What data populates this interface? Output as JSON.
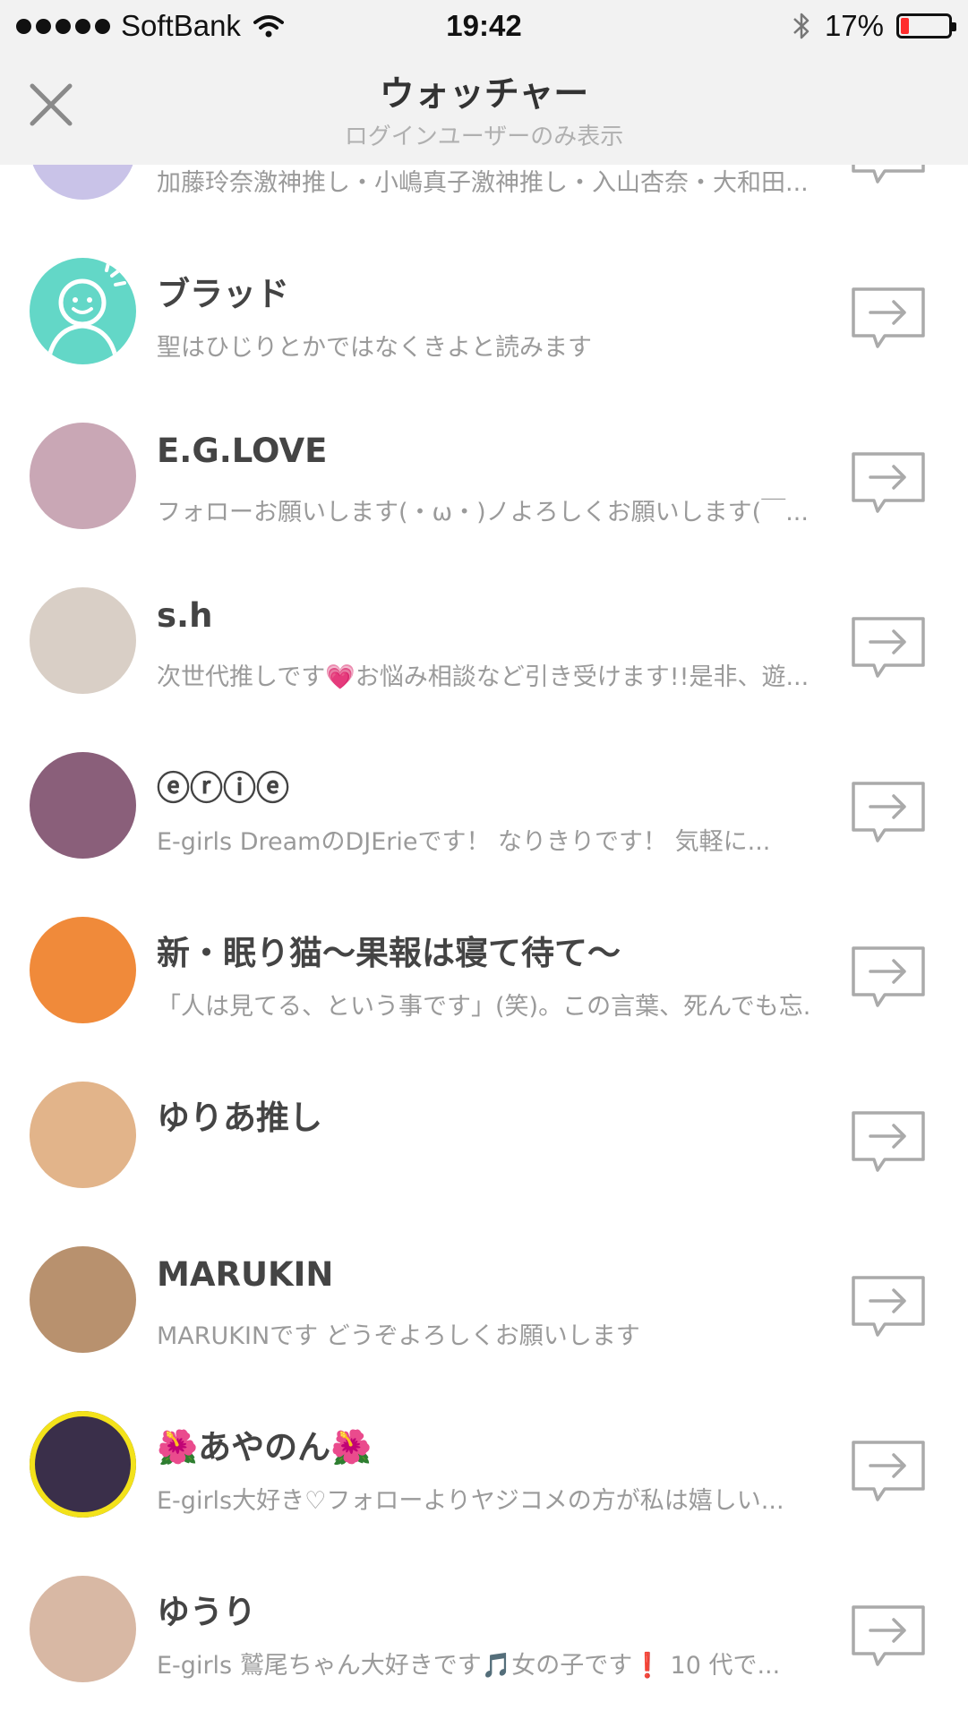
{
  "status_bar": {
    "carrier": "SoftBank",
    "time": "19:42",
    "battery_percent": "17%",
    "battery_level": 0.17
  },
  "nav": {
    "title": "ウォッチャー",
    "subtitle": "ログインユーザーのみ表示"
  },
  "partial_row": {
    "desc": "加藤玲奈激神推し・小嶋真子激神推し・入山杏奈・大和田..."
  },
  "users": [
    {
      "name": "ブラッド",
      "desc": "聖はひじりとかではなくきよと読みます",
      "avatar": "smiley-avatar-icon",
      "avatar_color": "#63d7c7"
    },
    {
      "name": "E.G.LOVE",
      "desc": "フォローお願いします(・ω・)ノよろしくお願いします(￣...",
      "avatar": "photo-collage-avatar",
      "avatar_color": "#c9a7b5"
    },
    {
      "name": "s.h",
      "desc": "次世代推しです💗お悩み相談など引き受けます!!是非、遊...",
      "avatar": "group-photo-avatar",
      "avatar_color": "#d9cfc6"
    },
    {
      "name": "ⓔⓡⓘⓔ",
      "desc": "E-girls DreamのDJErieです！ なりきりです！ 気軽に...",
      "avatar": "stage-photo-avatar",
      "avatar_color": "#8a5f7a"
    },
    {
      "name": "新・眠り猫〜果報は寝て待て〜",
      "desc": "「人は見てる、という事です」(笑)。この言葉、死んでも忘...",
      "avatar": "cat-pot-avatar-icon",
      "avatar_color": "#f08a3a"
    },
    {
      "name": "ゆりあ推し",
      "desc": "",
      "avatar": "anime-avatar",
      "avatar_color": "#e2b48a"
    },
    {
      "name": "MARUKIN",
      "desc": "MARUKINです どうぞよろしくお願いします",
      "avatar": "glasses-portrait-avatar",
      "avatar_color": "#b8916e"
    },
    {
      "name": "🌺あやのん🌺",
      "desc": "E-girls大好き♡フォローよりヤジコメの方が私は嬉しい...",
      "avatar": "yellow-ring-avatar",
      "avatar_color": "#3a2f4a"
    },
    {
      "name": "ゆうり",
      "desc": "E-girls 鷲尾ちゃん大好きです🎵女の子です❗️ 10 代で...",
      "avatar": "portrait-avatar",
      "avatar_color": "#d8b8a4"
    }
  ]
}
